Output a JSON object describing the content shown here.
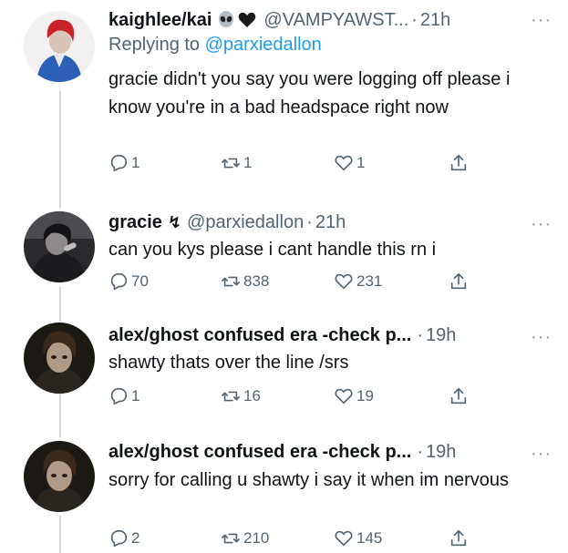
{
  "tweets": [
    {
      "name": "kaighlee/kai",
      "handle": "@VAMPYAWST...",
      "time": "21h",
      "more": "···",
      "reply_prefix": "Replying to",
      "reply_handle": "@parxiedallon",
      "text": "gracie didn't you say you were logging off please i know you're in a bad headspace right now",
      "replies": "1",
      "retweets": "1",
      "likes": "1",
      "icons": [
        "alien-emoji",
        "black-heart-emoji"
      ]
    },
    {
      "name": "gracie",
      "name_symbol": "↯",
      "handle": "@parxiedallon",
      "time": "21h",
      "more": "···",
      "text": "can you kys please i cant handle this rn i",
      "replies": "70",
      "retweets": "838",
      "likes": "231"
    },
    {
      "name": "alex/ghost confused era -check p...",
      "time": "19h",
      "more": "···",
      "text": "shawty thats over the line /srs",
      "replies": "1",
      "retweets": "16",
      "likes": "19"
    },
    {
      "name": "alex/ghost confused era -check p...",
      "time": "19h",
      "more": "···",
      "text": "sorry for calling u shawty i say it when im nervous",
      "replies": "2",
      "retweets": "210",
      "likes": "145"
    }
  ],
  "colors": {
    "text": "#0f1419",
    "secondary": "#536471",
    "link": "#1d9bf0",
    "thread_line": "#cfd9de"
  }
}
